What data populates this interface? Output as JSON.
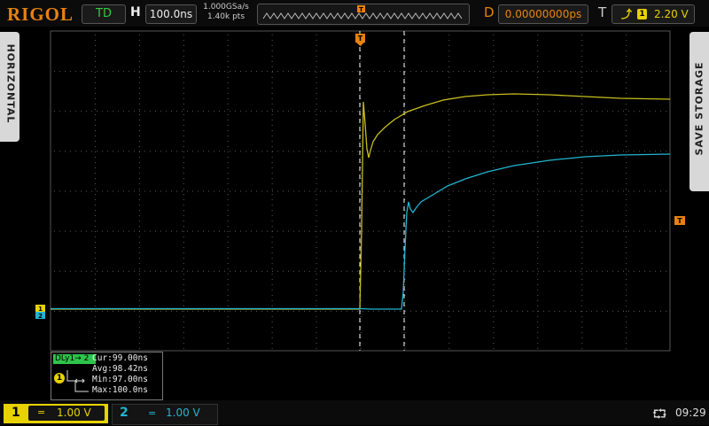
{
  "header": {
    "brand": "RIGOL",
    "run_status": "TD",
    "timebase_label": "H",
    "timebase_value": "100.0ns",
    "sample_rate": "1.000GSa/s",
    "memory_depth": "1.40k pts",
    "delay_label": "D",
    "delay_value": "0.00000000ps",
    "trigger_label": "T",
    "trigger_source": "1",
    "trigger_level": "2.20 V"
  },
  "side_tabs": {
    "left": "HORIZONTAL",
    "right": "SAVE STORAGE"
  },
  "markers": {
    "trigger_top": "T",
    "trigger_level_right": "T",
    "ch1_ground": "1",
    "ch2_ground": "2"
  },
  "measurement": {
    "header": "DLy1→ 2",
    "source_channel": "1",
    "cur": "Cur:99.00ns",
    "avg": "Avg:98.42ns",
    "min": "Min:97.00ns",
    "max": "Max:100.0ns"
  },
  "footer": {
    "ch1": {
      "number": "1",
      "coupling": "=",
      "scale": "1.00 V"
    },
    "ch2": {
      "number": "2",
      "coupling": "=",
      "scale": "1.00 V"
    },
    "clock": "09:29"
  },
  "colors": {
    "ch1": "#c8be1e",
    "ch2": "#22b5d0",
    "accent": "#e8820f",
    "grid": "#3a3a3a"
  },
  "icons": {
    "usb": "usb-icon",
    "trigger_edge": "rising-edge-icon"
  }
}
